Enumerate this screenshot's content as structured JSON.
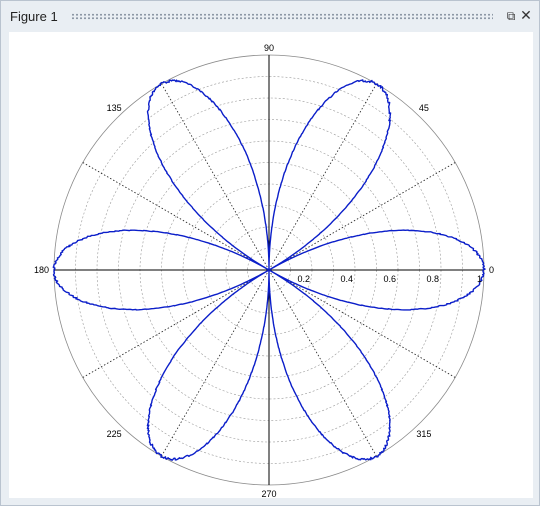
{
  "window": {
    "title": "Figure 1",
    "undock_icon": "undock-icon",
    "close_icon": "close-icon",
    "undock_glyph": "⧉",
    "close_glyph": "✕"
  },
  "chart_data": {
    "type": "polar",
    "title": "",
    "series": [
      {
        "name": "",
        "equation_shape": "rho = |cos(3*theta)|, six-petal rose",
        "petal_count": 6,
        "petal_angles_deg": [
          0,
          60,
          120,
          180,
          240,
          300
        ],
        "max_radius": 1.0,
        "color": "#0b1ec9",
        "noisy": true
      }
    ],
    "rlim": [
      0,
      1.0
    ],
    "radial_ticks": [
      "0.2",
      "0.4",
      "0.6",
      "0.8",
      "1"
    ],
    "angular_ticks": [
      "0",
      "45",
      "90",
      "135",
      "180",
      "225",
      "270",
      "315"
    ],
    "radial_gridlines": [
      0.1,
      0.2,
      0.3,
      0.4,
      0.5,
      0.6,
      0.7,
      0.8,
      0.9,
      1.0
    ],
    "grid": true,
    "background": "#ffffff",
    "grid_color": "#9a9a9a"
  }
}
